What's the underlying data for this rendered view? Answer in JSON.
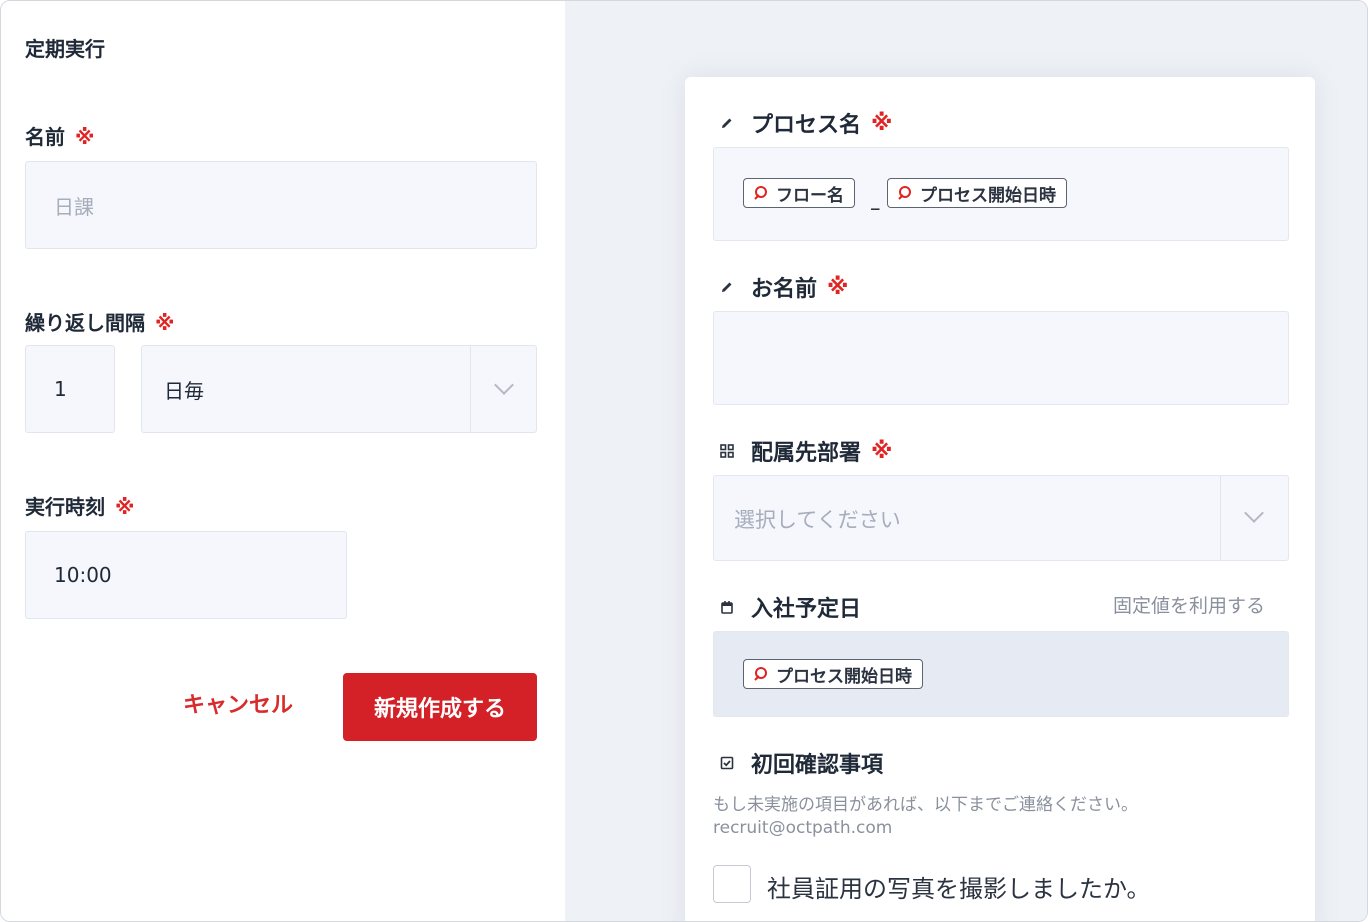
{
  "left": {
    "title": "定期実行",
    "required_mark": "※",
    "name": {
      "label": "名前",
      "placeholder": "日課"
    },
    "interval": {
      "label": "繰り返し間隔",
      "value": "1",
      "unit": "日毎"
    },
    "time": {
      "label": "実行時刻",
      "value": "10:00"
    },
    "cancel_label": "キャンセル",
    "create_label": "新規作成する"
  },
  "form": {
    "required_mark": "※",
    "process_name": {
      "label": "プロセス名",
      "tags": [
        "フロー名",
        "プロセス開始日時"
      ],
      "separator": "_"
    },
    "person_name": {
      "label": "お名前",
      "value": ""
    },
    "department": {
      "label": "配属先部署",
      "placeholder": "選択してください"
    },
    "join_date": {
      "label": "入社予定日",
      "fixed_link": "固定値を利用する",
      "tag": "プロセス開始日時"
    },
    "confirm": {
      "label": "初回確認事項",
      "hint_line1": "もし未実施の項目があれば、以下までご連絡ください。",
      "hint_line2": "recruit@octpath.com",
      "checkbox_label": "社員証用の写真を撮影しましたか。"
    }
  },
  "colors": {
    "accent": "#d42027",
    "required": "#e02424"
  },
  "icons": {
    "edit": "pencil-icon",
    "org": "org-chart-icon",
    "calendar": "calendar-icon",
    "checklist": "checkbox-icon",
    "variable": "variable-icon"
  }
}
